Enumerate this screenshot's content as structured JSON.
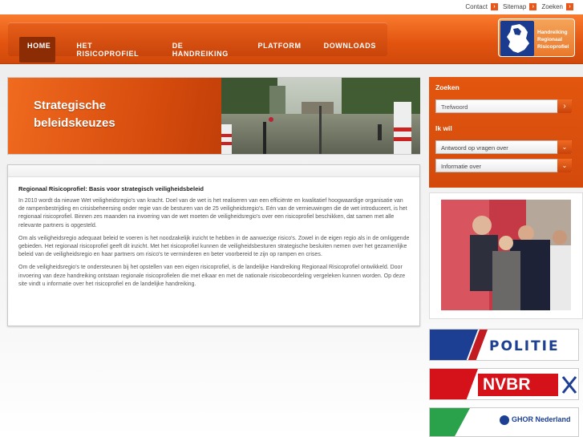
{
  "toplinks": [
    {
      "label": "Contact"
    },
    {
      "label": "Sitemap"
    },
    {
      "label": "Zoeken"
    }
  ],
  "nav": {
    "items": [
      {
        "label": "Home",
        "active": true
      },
      {
        "label": "Het risicoprofiel"
      },
      {
        "label": "De handreiking"
      },
      {
        "label": "Platform"
      },
      {
        "label": "Downloads"
      }
    ]
  },
  "logo": {
    "line1": "Handreiking",
    "line2": "Regionaal",
    "line3": "Risicoprofiel"
  },
  "banner": {
    "line1": "Strategische",
    "line2": "beleidskeuzes"
  },
  "article": {
    "title": "Regionaal Risicoprofiel: Basis voor strategisch veiligheidsbeleid",
    "p1": "In 2010 wordt da nieuwe Wet veiligheidsregio's van kracht. Doel van de wet is het realiseren van een efficiënte en kwalitatief hoogwaardige organisatie van de rampenbestrijding en crisisbeheersing onder regie van de besturen van de 25 veiligheidsregio's. Eén van de vernieuwingen die de wet introduceert, is het regionaal risicoprofiel. Binnen zes maanden na invoering van de wet moeten de veiligheidsregio's over een risicoprofiel beschikken, dat samen met alle relevante partners is opgesteld.",
    "p2": "Om als veiligheidsregio adequaat beleid te voeren is het noodzakelijk inzicht te hebben in de aanwezige risico's. Zowel in de eigen regio als in de omliggende gebieden. Het regionaal risicoprofiel geeft dit inzicht. Met het risicoprofiel kunnen de veiligheidsbesturen strategische besluiten nemen over het gezamenlijke beleid van de veiligheidsregio en haar partners om risico's te verminderen en beter voorbereid te zijn op rampen en crises.",
    "p3": "Om de veiligheidsregio's te ondersteunen bij het opstellen van een eigen risicoprofiel, is de landelijke Handreiking Regionaal Risicoprofiel ontwikkeld. Door invoering van deze handreiking ontstaan regionale risicoprofielen die met elkaar en met de nationale risicobeoordeling vergeleken kunnen worden. Op deze site vindt u informatie over het risicoprofiel en de landelijke handreiking."
  },
  "sidebar": {
    "search_title": "Zoeken",
    "search_placeholder": "Trefwoord",
    "search_button": "›",
    "ikwil_title": "Ik wil",
    "select1": "Antwoord op vragen over",
    "select2": "Informatie over"
  },
  "partners": {
    "politie": "POLITIE",
    "nvbr": "NVBR",
    "ghor": "GHOR Nederland"
  },
  "colors": {
    "accent": "#e8561a",
    "nav_dark": "#8c2c05",
    "politie_blue": "#1c3f94",
    "nvbr_red": "#d5121a"
  }
}
